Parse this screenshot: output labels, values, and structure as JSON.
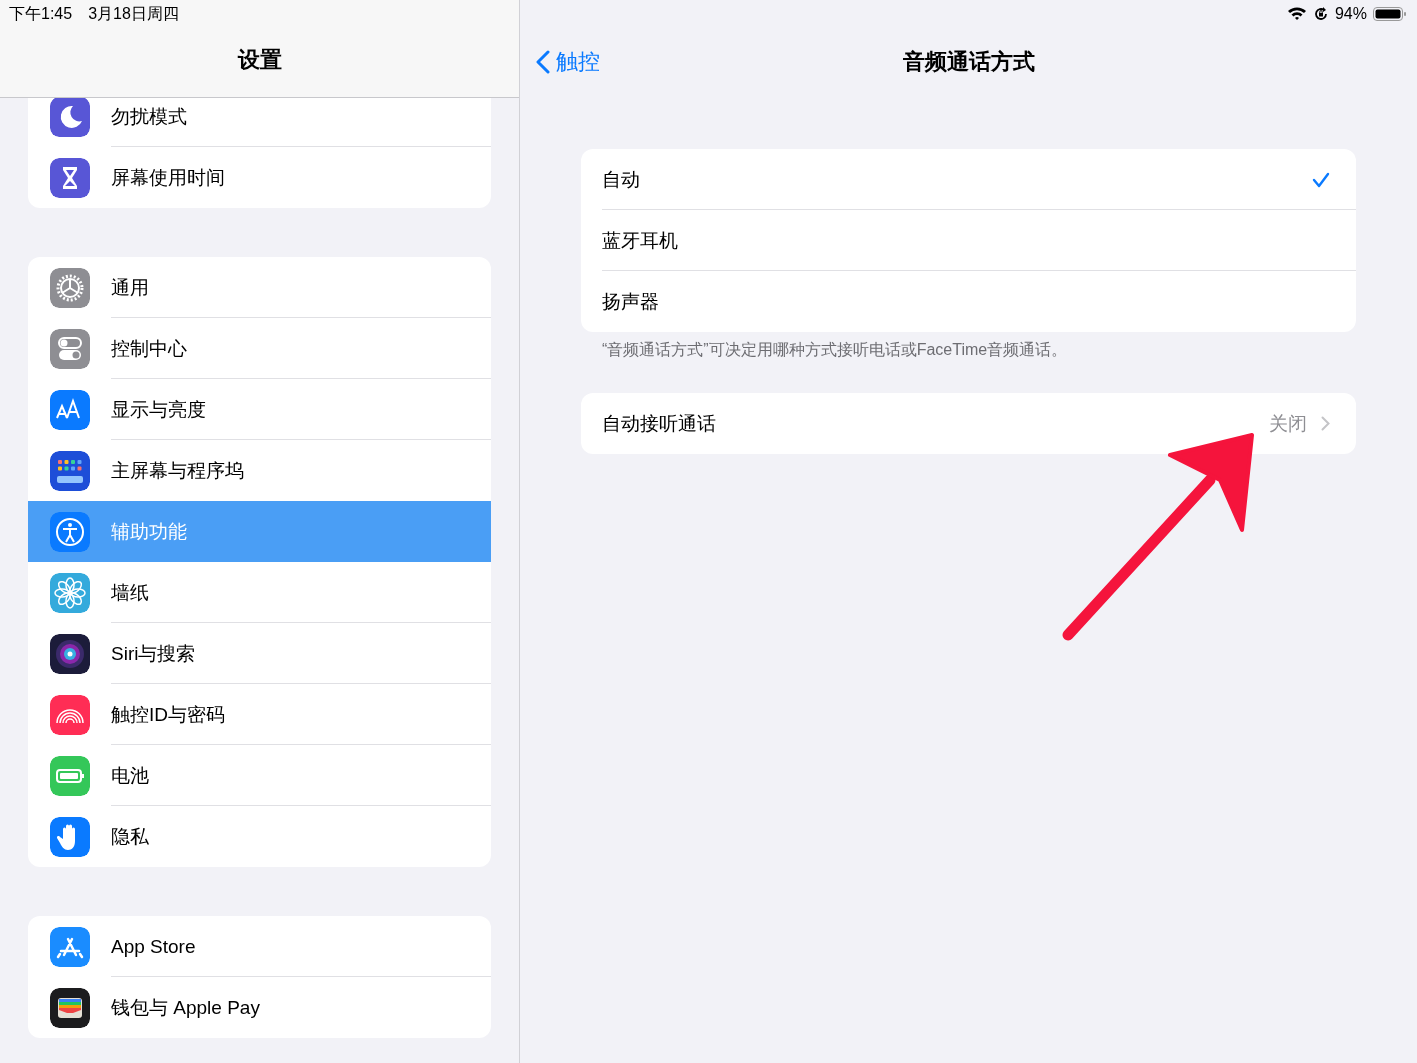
{
  "status_bar": {
    "time": "下午1:45",
    "date": "3月18日周四",
    "battery": "94%"
  },
  "sidebar": {
    "title": "设置",
    "groups": [
      {
        "items": [
          {
            "label": "勿扰模式",
            "selected": false
          },
          {
            "label": "屏幕使用时间",
            "selected": false
          }
        ]
      },
      {
        "items": [
          {
            "label": "通用",
            "selected": false
          },
          {
            "label": "控制中心",
            "selected": false
          },
          {
            "label": "显示与亮度",
            "selected": false
          },
          {
            "label": "主屏幕与程序坞",
            "selected": false
          },
          {
            "label": "辅助功能",
            "selected": true
          },
          {
            "label": "墙纸",
            "selected": false
          },
          {
            "label": "Siri与搜索",
            "selected": false
          },
          {
            "label": "触控ID与密码",
            "selected": false
          },
          {
            "label": "电池",
            "selected": false
          },
          {
            "label": "隐私",
            "selected": false
          }
        ]
      },
      {
        "items": [
          {
            "label": "App Store",
            "selected": false
          },
          {
            "label": "钱包与 Apple Pay",
            "selected": false
          }
        ]
      }
    ]
  },
  "detail": {
    "back": "触控",
    "title": "音频通话方式",
    "options": [
      {
        "label": "自动",
        "selected": true
      },
      {
        "label": "蓝牙耳机",
        "selected": false
      },
      {
        "label": "扬声器",
        "selected": false
      }
    ],
    "note": "“音频通话方式”可决定用哪种方式接听电话或FaceTime音频通话。",
    "auto_answer": {
      "label": "自动接听通话",
      "value": "关闭"
    }
  }
}
